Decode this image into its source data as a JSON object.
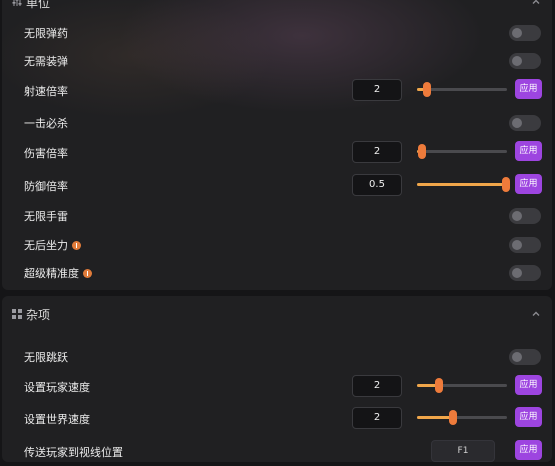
{
  "section_weapons": {
    "title": "单位",
    "icon": "sliders-icon",
    "rows": [
      {
        "label": "无限弹药",
        "type": "toggle",
        "on": false
      },
      {
        "label": "无需装弹",
        "type": "toggle",
        "on": false
      },
      {
        "label": "射速倍率",
        "type": "slider",
        "value": "2",
        "level": 0.11,
        "apply": "应用"
      },
      {
        "label": "一击必杀",
        "type": "toggle",
        "on": false
      },
      {
        "label": "伤害倍率",
        "type": "slider",
        "value": "2",
        "level": 0.05,
        "apply": "应用"
      },
      {
        "label": "防御倍率",
        "type": "slider",
        "value": "0.5",
        "level": 1.0,
        "apply": "应用"
      },
      {
        "label": "无限手雷",
        "type": "toggle",
        "on": false
      },
      {
        "label": "无后坐力",
        "type": "toggle",
        "on": false,
        "info": true
      },
      {
        "label": "超级精准度",
        "type": "toggle",
        "on": false,
        "info": true
      }
    ]
  },
  "section_misc": {
    "title": "杂项",
    "icon": "grid-icon",
    "rows": [
      {
        "label": "无限跳跃",
        "type": "toggle",
        "on": false
      },
      {
        "label": "设置玩家速度",
        "type": "slider",
        "value": "2",
        "level": 0.24,
        "apply": "应用"
      },
      {
        "label": "设置世界速度",
        "type": "slider",
        "value": "2",
        "level": 0.4,
        "apply": "应用"
      },
      {
        "label": "传送玩家到视线位置",
        "type": "key",
        "key": "F1",
        "apply": "应用"
      }
    ]
  },
  "colors": {
    "accent": "#9d45e0",
    "slider_fill": "#f0a64a",
    "slider_thumb": "#ee7b3b",
    "info": "#e07b3a"
  }
}
